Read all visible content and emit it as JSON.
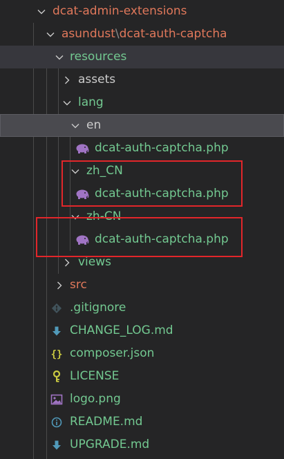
{
  "colors": {
    "background": "#252526",
    "git_untracked_green": "#73c991",
    "git_modified_red": "#e0785b",
    "default_text": "#cccccc",
    "annotation_red": "#e3262a"
  },
  "tree": {
    "root": {
      "label": "dcat-admin-extensions"
    },
    "package": {
      "owner": "asundust",
      "separator": "\\",
      "name": "dcat-auth-captcha"
    },
    "resources": {
      "label": "resources"
    },
    "assets": {
      "label": "assets"
    },
    "lang": {
      "label": "lang"
    },
    "en": {
      "label": "en",
      "file": "dcat-auth-captcha.php"
    },
    "zh_CN_underscore": {
      "label": "zh_CN",
      "file": "dcat-auth-captcha.php"
    },
    "zh_CN_hyphen": {
      "label": "zh-CN",
      "file": "dcat-auth-captcha.php"
    },
    "views": {
      "label": "views"
    },
    "src": {
      "label": "src"
    },
    "files": [
      {
        "label": ".gitignore",
        "icon": "git-icon"
      },
      {
        "label": "CHANGE_LOG.md",
        "icon": "markdown-arrow-icon"
      },
      {
        "label": "composer.json",
        "icon": "json-braces-icon"
      },
      {
        "label": "LICENSE",
        "icon": "license-key-icon"
      },
      {
        "label": "logo.png",
        "icon": "image-icon"
      },
      {
        "label": "README.md",
        "icon": "info-icon"
      },
      {
        "label": "UPGRADE.md",
        "icon": "markdown-arrow-icon"
      }
    ]
  }
}
